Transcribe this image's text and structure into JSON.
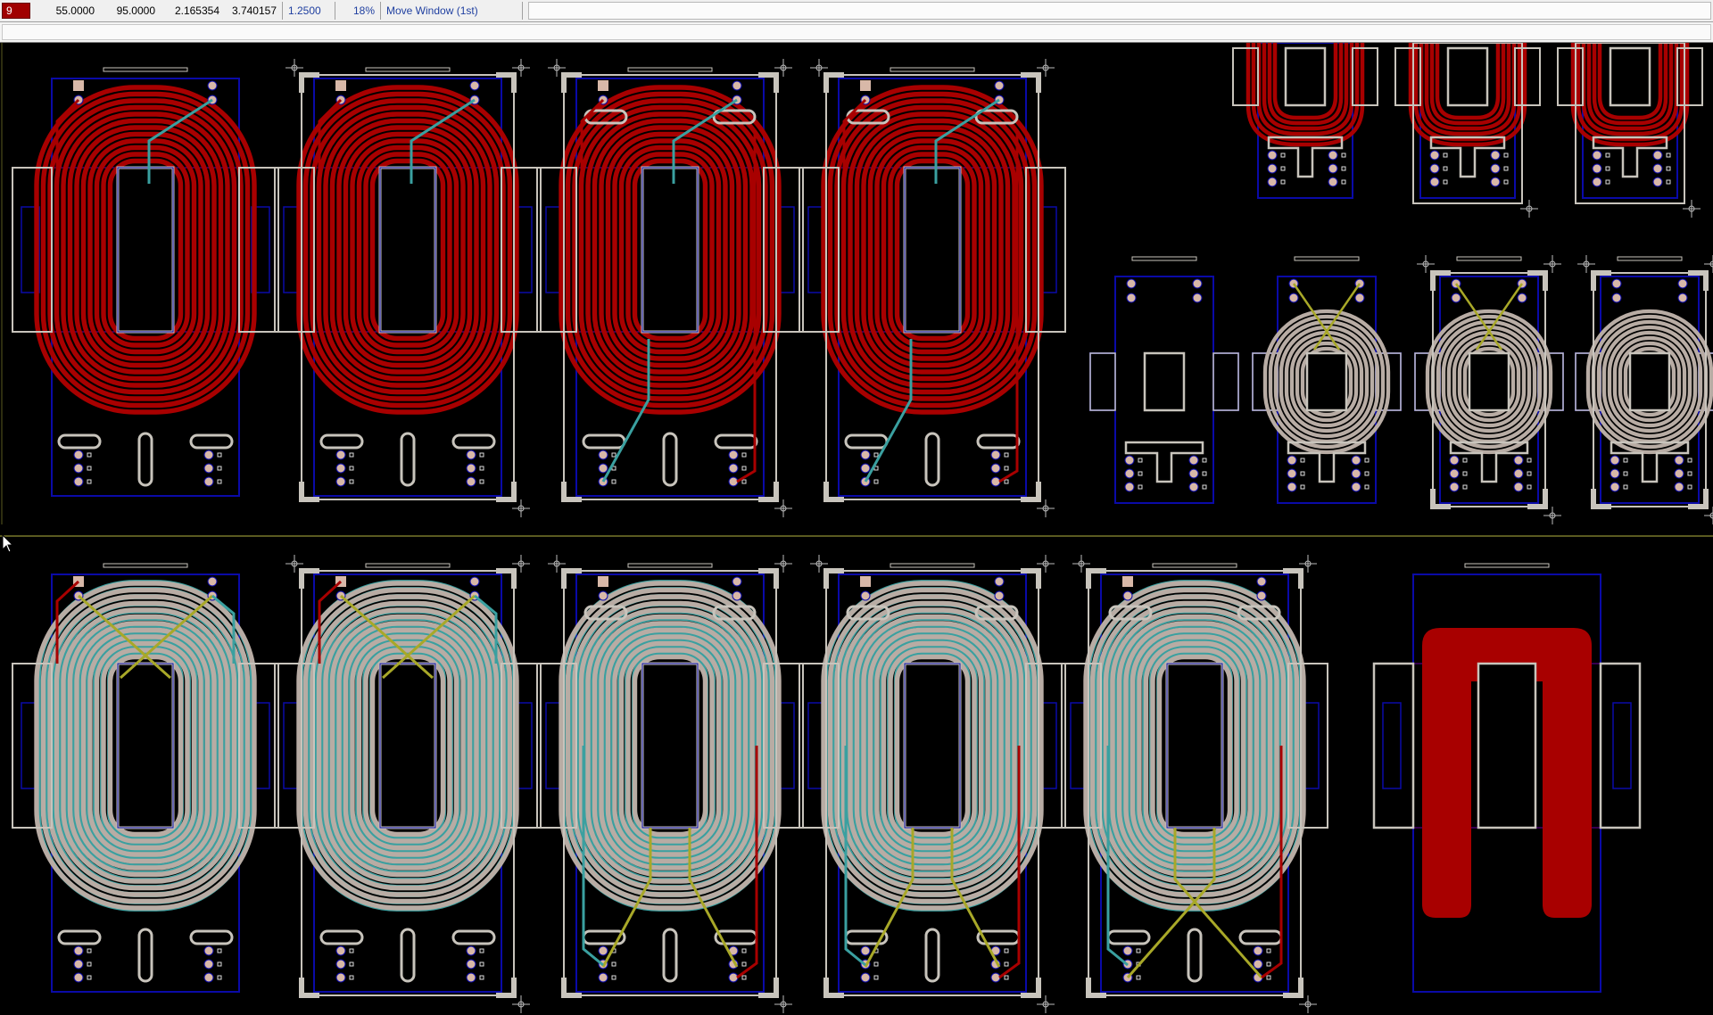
{
  "status": {
    "layer": "9",
    "x": "55.0000",
    "y": "95.0000",
    "x_in": "2.165354",
    "y_in": "3.740157",
    "grid": "1.2500",
    "zoom": "18%",
    "command": "Move Window (1st)"
  },
  "colors": {
    "background": "#000000",
    "outline": "#0a0aa8",
    "silk": "#c8c4bc",
    "top_copper": "#a80000",
    "bottom_copper": "#b8aca4",
    "via": "#3aa0a0",
    "jumper": "#a8a828",
    "guide": "#6a00a0",
    "divider": "#5a5a20"
  },
  "row1_boards": [
    {
      "variant": "red-spiral-clips",
      "frame": false
    },
    {
      "variant": "red-spiral-clips",
      "frame": true
    },
    {
      "variant": "red-spiral-ovals",
      "frame": true
    },
    {
      "variant": "red-spiral-ovals",
      "frame": true
    }
  ],
  "row1_small": [
    {
      "variant": "empty"
    },
    {
      "variant": "gray-coil-cross"
    },
    {
      "variant": "gray-coil-cross",
      "frame": true
    },
    {
      "variant": "gray-coil",
      "frame": true
    }
  ],
  "row2_boards": [
    {
      "variant": "gray-coil-cross",
      "frame": false
    },
    {
      "variant": "gray-coil-cross",
      "frame": true
    },
    {
      "variant": "gray-coil-bottom",
      "frame": true
    },
    {
      "variant": "gray-coil-bottom",
      "frame": true
    },
    {
      "variant": "gray-coil-bottom-cross",
      "frame": true
    },
    {
      "variant": "solid-red-u",
      "frame": false
    }
  ]
}
